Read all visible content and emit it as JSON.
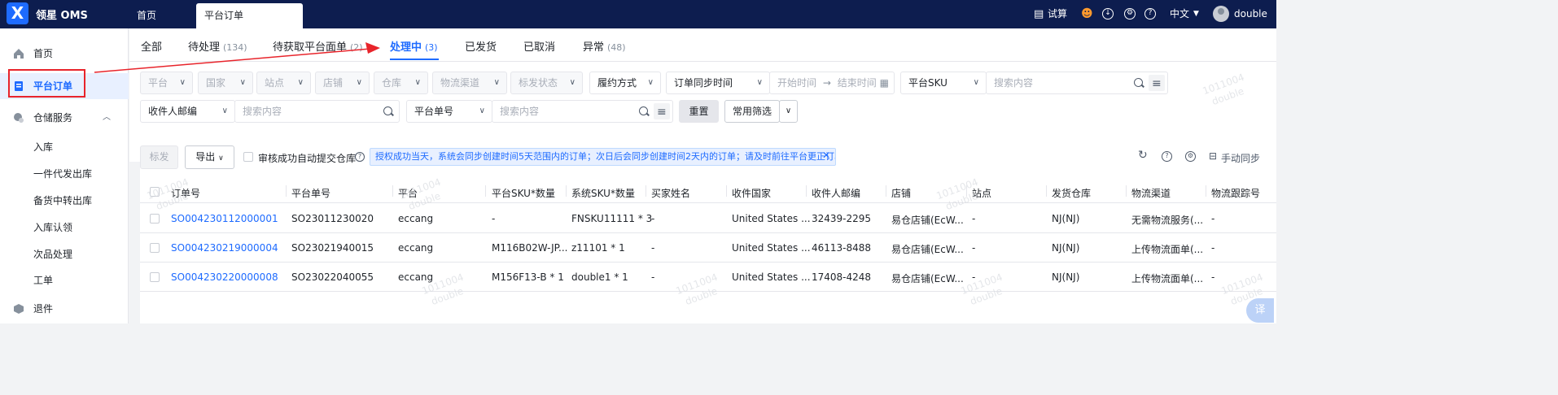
{
  "app": {
    "logo_letter": "X",
    "name": "领星 OMS"
  },
  "top_tabs": {
    "home": "首页",
    "active": "平台订单"
  },
  "top_right": {
    "trial": "试算",
    "language": "中文",
    "user": "double"
  },
  "sidebar": {
    "home": "首页",
    "platform_orders": "平台订单",
    "warehouse_service": "仓储服务",
    "sub_items": [
      "入库",
      "一件代发出库",
      "备货中转出库",
      "入库认领",
      "次品处理",
      "工单"
    ],
    "returns": "退件"
  },
  "status_tabs": [
    {
      "label": "全部",
      "count": ""
    },
    {
      "label": "待处理",
      "count": "(134)"
    },
    {
      "label": "待获取平台面单",
      "count": "(2)"
    },
    {
      "label": "处理中",
      "count": "(3)"
    },
    {
      "label": "已发货",
      "count": ""
    },
    {
      "label": "已取消",
      "count": ""
    },
    {
      "label": "异常",
      "count": "(48)"
    }
  ],
  "filters": {
    "row1": [
      "平台",
      "国家",
      "站点",
      "店铺",
      "仓库",
      "物流渠道",
      "标发状态",
      "履约方式"
    ],
    "sync_time": "订单同步时间",
    "start_time": "开始时间",
    "end_time": "结束时间",
    "platform_sku": "平台SKU",
    "search_placeholder": "搜索内容",
    "recipient_email": "收件人邮编",
    "platform_order_no": "平台单号",
    "reset": "重置",
    "common_filter": "常用筛选"
  },
  "toolbar": {
    "ship": "标发",
    "export": "导出",
    "auto_submit": "审核成功自动提交仓库",
    "notice": "授权成功当天，系统会同步创建时间5天范围内的订单；次日后会同步创建时间2天内的订单；请及时前往平台更正订单信息。",
    "manual_sync": "手动同步"
  },
  "table": {
    "headers": [
      "订单号",
      "平台单号",
      "平台",
      "平台SKU*数量",
      "系统SKU*数量",
      "买家姓名",
      "收件国家",
      "收件人邮编",
      "店铺",
      "站点",
      "发货仓库",
      "物流渠道",
      "物流跟踪号"
    ],
    "rows": [
      [
        "SO004230112000001",
        "SO23011230020",
        "eccang",
        "-",
        "FNSKU11111 * 3",
        "-",
        "United States ...",
        "32439-2295",
        "易仓店铺(EcW...",
        "-",
        "NJ(NJ)",
        "无需物流服务(...",
        "-"
      ],
      [
        "SO004230219000004",
        "SO23021940015",
        "eccang",
        "M116B02W-JP...",
        "z11101 * 1",
        "-",
        "United States ...",
        "46113-8488",
        "易仓店铺(EcW...",
        "-",
        "NJ(NJ)",
        "上传物流面单(...",
        "-"
      ],
      [
        "SO004230220000008",
        "SO23022040055",
        "eccang",
        "M156F13-B * 1",
        "double1 * 1",
        "-",
        "United States ...",
        "17408-4248",
        "易仓店铺(EcW...",
        "-",
        "NJ(NJ)",
        "上传物流面单(...",
        "-"
      ]
    ]
  },
  "watermark": {
    "line1": "1011004",
    "line2": "double"
  },
  "translate_badge": "译",
  "colors": {
    "topbar": "#0d1d4f",
    "accent": "#1e6bff",
    "highlight": "#e8242b"
  }
}
